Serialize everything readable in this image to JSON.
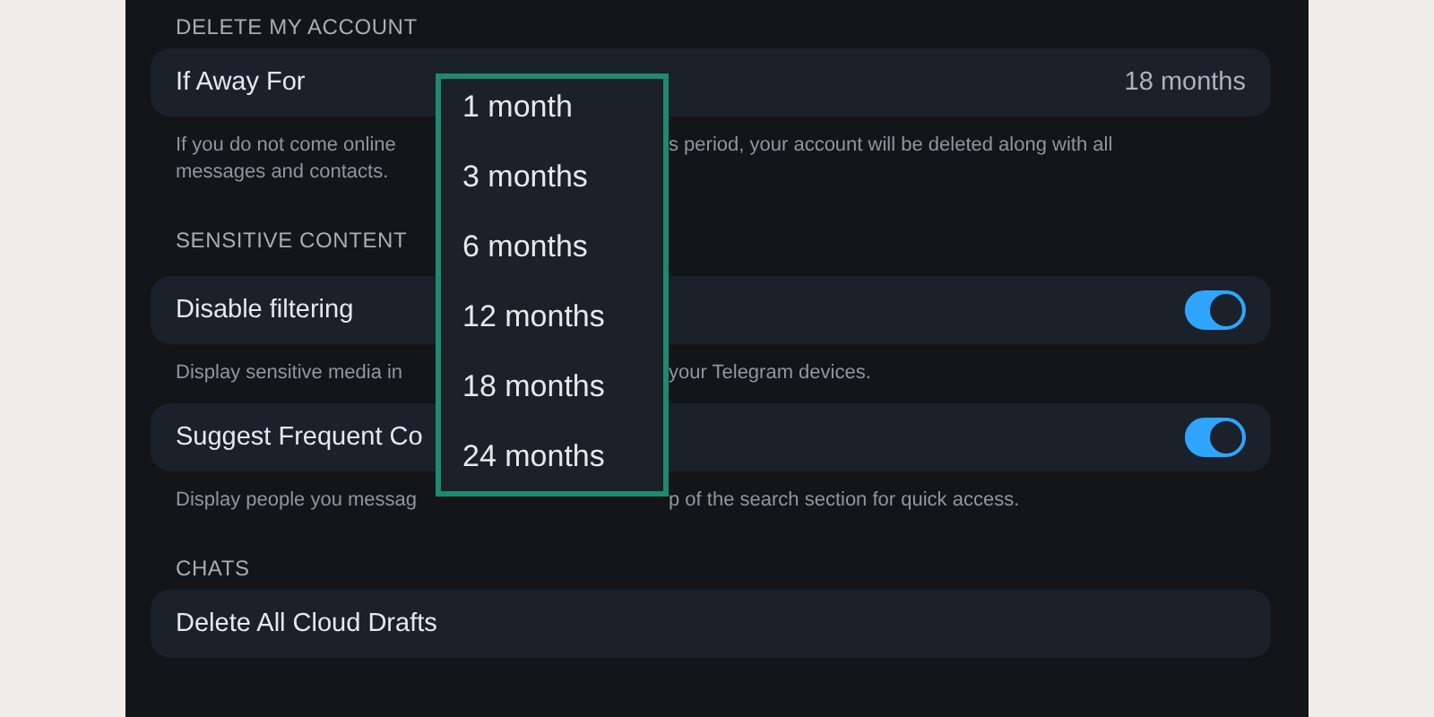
{
  "sections": [
    {
      "header": "DELETE MY ACCOUNT",
      "rows": [
        {
          "kind": "value",
          "label": "If Away For",
          "value": "18 months",
          "note": [
            [
              "If you do not come online",
              "s period, your account will be deleted along with all"
            ],
            [
              "messages and contacts."
            ]
          ]
        }
      ]
    },
    {
      "header": "SENSITIVE CONTENT",
      "rows": [
        {
          "kind": "toggle",
          "label": "Disable filtering",
          "on": true,
          "note": [
            [
              "Display sensitive media in",
              "your Telegram devices."
            ]
          ]
        },
        {
          "kind": "toggle",
          "label": "Suggest Frequent Co",
          "on": true,
          "note": [
            [
              "Display people you messag",
              "p of the search section for quick access."
            ]
          ]
        }
      ]
    },
    {
      "header": "CHATS",
      "rows": [
        {
          "kind": "action",
          "label": "Delete All Cloud Drafts"
        }
      ]
    }
  ],
  "dropdown": {
    "options": [
      "1 month",
      "3 months",
      "6 months",
      "12 months",
      "18 months",
      "24 months"
    ]
  }
}
